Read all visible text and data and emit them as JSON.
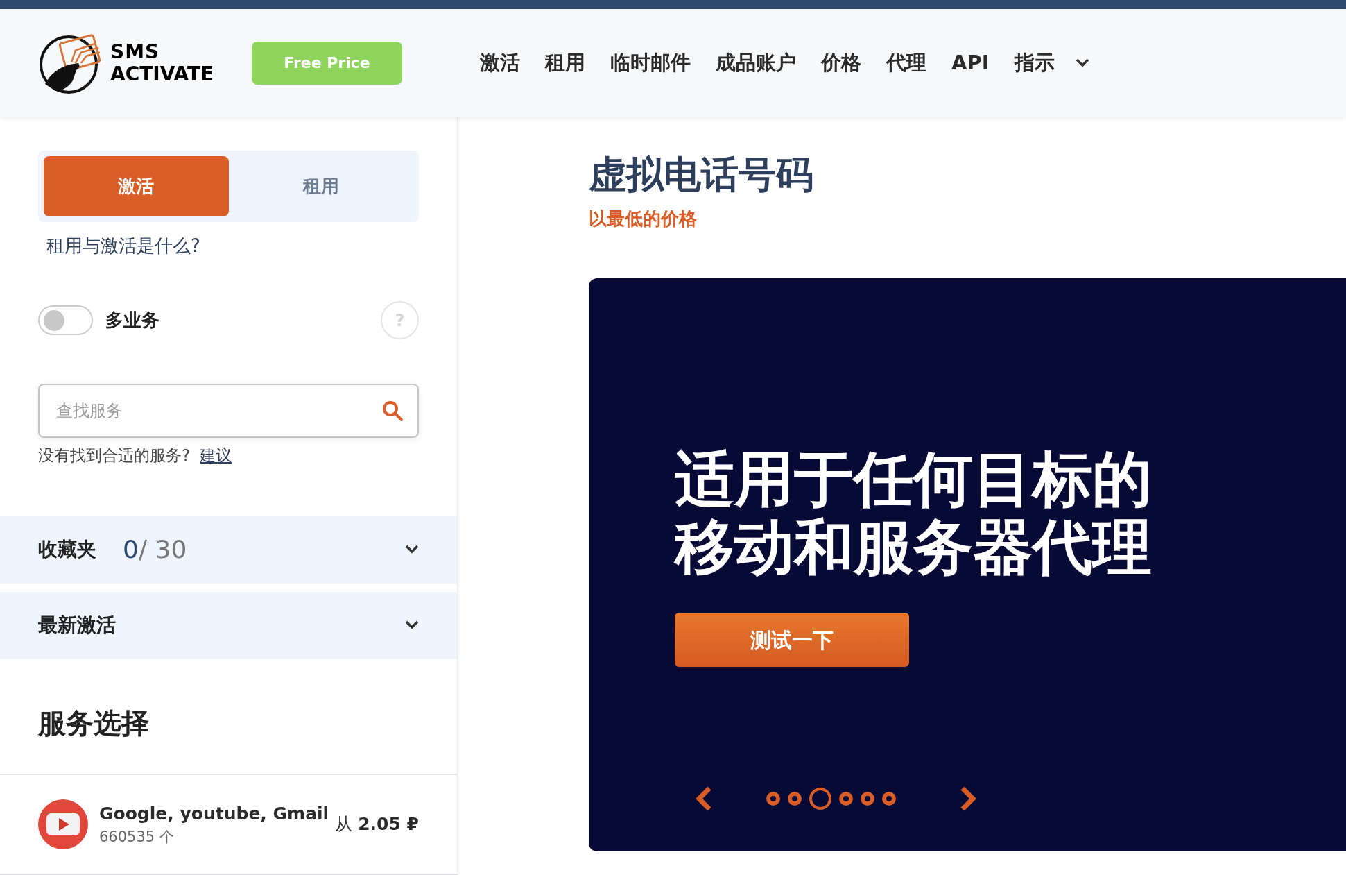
{
  "header": {
    "logo": {
      "line_1": "SMS",
      "line_2": "ACTIVATE"
    },
    "free_price_button": "Free Price",
    "nav": [
      {
        "label": "激活"
      },
      {
        "label": "租用"
      },
      {
        "label": "临时邮件"
      },
      {
        "label": "成品账户"
      },
      {
        "label": "价格"
      },
      {
        "label": "代理"
      },
      {
        "label": "API"
      },
      {
        "label": "指示",
        "dropdown": true
      }
    ]
  },
  "sidebar": {
    "mode_tabs": [
      {
        "label": "激活",
        "selected": true
      },
      {
        "label": "租用",
        "selected": false
      }
    ],
    "help_link": "租用与激活是什么?",
    "multi_service": {
      "label": "多业务",
      "on": false,
      "help": "?"
    },
    "search": {
      "placeholder": "查找服务"
    },
    "suggest": {
      "text": "没有找到合适的服务?",
      "link": "建议"
    },
    "sections": [
      {
        "title": "收藏夹",
        "count": "0",
        "total": "/ 30",
        "expanded": false
      },
      {
        "title": "最新激活",
        "expanded": false
      }
    ],
    "services_heading": "服务选择",
    "services": [
      {
        "name": "Google, youtube, Gmail",
        "count": "660535 个",
        "price_prefix": "从",
        "price": "2.05 ₽"
      }
    ]
  },
  "main": {
    "title": "虚拟电话号码",
    "subtitle": "以最低的价格",
    "banner": {
      "headline_1": "适用于任何目标的",
      "headline_2": "移动和服务器代理",
      "button": "测试一下",
      "dots": [
        {
          "selected": false
        },
        {
          "selected": false
        },
        {
          "selected": true
        },
        {
          "selected": false
        },
        {
          "selected": false
        },
        {
          "selected": false
        }
      ]
    }
  }
}
